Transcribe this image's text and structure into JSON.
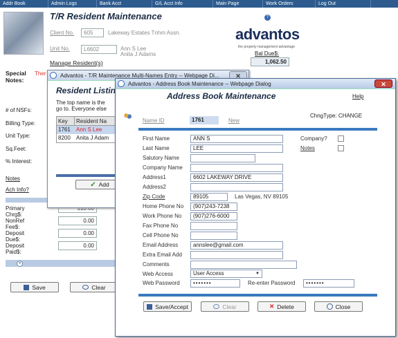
{
  "menu": [
    "Addr Book",
    "Admin Logs",
    "Bank Acct",
    "G/L Acct Info",
    "Main Page",
    "Work Orders",
    "Log Out"
  ],
  "main": {
    "title": "T/R Resident Maintenance",
    "client_no_label": "Client No.",
    "client_no": "605",
    "client_name": "Lakeway Estates Tnhm Assn.",
    "unit_no_label": "Unit No.",
    "unit_no": "L6602",
    "resident1": "Ann S Lee",
    "resident2": "Anita J Adams",
    "manage_link": "Manage Resident(s)",
    "bal_due_label": "Bal Due$:",
    "bal_due": "1,062.50",
    "logo": "advantos",
    "tagline": "the property management advantage",
    "special_notes_label": "Special Notes:",
    "special_notes_value": "Ther",
    "fields": [
      "# of NSFs:",
      "Billing Type:",
      "Unit Type:",
      "Sq.Feet:",
      "% Interest:"
    ],
    "notes_link": "Notes",
    "ach_link": "Ach Info?",
    "charges": [
      {
        "label": "Primary Chrg$:",
        "value": "310.00"
      },
      {
        "label": "NonRef Fee$:",
        "value": "0.00"
      },
      {
        "label": "Deposit Due$:",
        "value": "0.00"
      },
      {
        "label": "Deposit Paid$:",
        "value": "0.00"
      }
    ],
    "save": "Save",
    "clear": "Clear"
  },
  "listing": {
    "title": "Advantos - T/R Maintenance Multi-Names Entry -- Webpage Di...",
    "heading": "Resident Listin",
    "text1": "The top name is the",
    "text2": "go to. Everyone else",
    "col_key": "Key",
    "col_name": "Resident Na",
    "rows": [
      {
        "key": "1761",
        "name": "Ann S Lee"
      },
      {
        "key": "8200",
        "name": "Anita J Adam"
      }
    ],
    "add": "Add"
  },
  "dialog": {
    "title": "Advantos - Address Book Maintenance -- Webpage Dialog",
    "heading": "Address Book Maintenance",
    "help": "Help",
    "name_id_label": "Name ID",
    "name_id": "1761",
    "new_link": "New",
    "chngtype": "ChngType:  CHANGE",
    "labels": {
      "first": "First Name",
      "last": "Last Name",
      "salutory": "Salutory Name",
      "company": "Company Name",
      "addr1": "Address1",
      "addr2": "Address2",
      "zip": "Zip Code",
      "home": "Home Phone No",
      "work": "Work Phone No",
      "fax": "Fax Phone No",
      "cell": "Cell Phone No",
      "email": "Email Address",
      "extra": "Extra Email Add",
      "comments": "Comments",
      "webaccess": "Web Access",
      "webpass": "Web Password",
      "reenter": "Re-enter Password",
      "company_q": "Company?",
      "notes": "Notes"
    },
    "values": {
      "first": "ANN S",
      "last": "LEE",
      "salutory": "",
      "company": "",
      "addr1": "6602 LAKEWAY DRIVE",
      "addr2": "",
      "zip": "89105",
      "city": "Las Vegas, NV 89105",
      "home": "(907)243-7238",
      "work": "(907)276-6000",
      "fax": "",
      "cell": "",
      "email": "annslee@gmail.com",
      "extra": "",
      "comments": "",
      "webaccess": "User Access",
      "webpass": "•••••••",
      "reenter": "•••••••"
    },
    "buttons": {
      "save": "Save/Accept",
      "clear": "Clear",
      "delete": "Delete",
      "close": "Close"
    }
  }
}
